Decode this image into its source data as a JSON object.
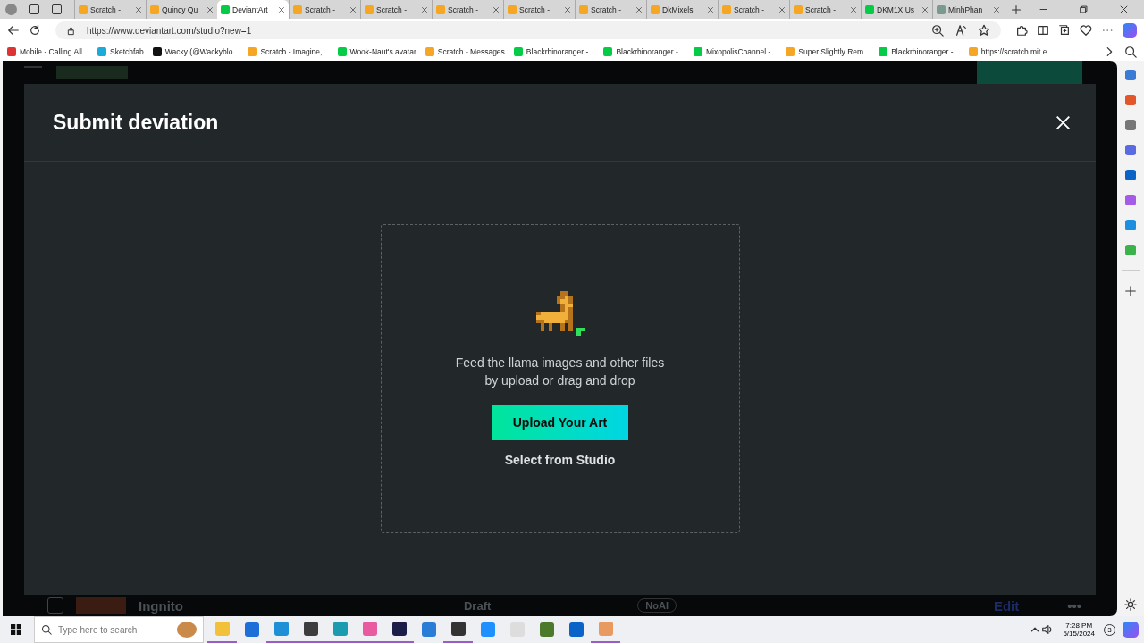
{
  "browser": {
    "tabs": [
      {
        "title": "Scratch -",
        "kind": "scratch",
        "selected": false
      },
      {
        "title": "Quincy Qu",
        "kind": "scratch",
        "selected": false
      },
      {
        "title": "DeviantArt",
        "kind": "deviantart",
        "selected": true
      },
      {
        "title": "Scratch -",
        "kind": "scratch",
        "selected": false
      },
      {
        "title": "Scratch -",
        "kind": "scratch",
        "selected": false
      },
      {
        "title": "Scratch -",
        "kind": "scratch",
        "selected": false
      },
      {
        "title": "Scratch -",
        "kind": "scratch",
        "selected": false
      },
      {
        "title": "Scratch -",
        "kind": "scratch",
        "selected": false
      },
      {
        "title": "DkMixels",
        "kind": "scratch",
        "selected": false
      },
      {
        "title": "Scratch -",
        "kind": "scratch",
        "selected": false
      },
      {
        "title": "Scratch -",
        "kind": "scratch",
        "selected": false
      },
      {
        "title": "DKM1X Us",
        "kind": "deviantart",
        "selected": false
      },
      {
        "title": "MinhPhan",
        "kind": "generic",
        "selected": false
      }
    ],
    "address": "https://www.deviantart.com/studio?new=1",
    "bookmarks": [
      {
        "title": "Mobile - Calling All...",
        "kind": "app"
      },
      {
        "title": "Sketchfab",
        "kind": "sketchfab"
      },
      {
        "title": "Wacky (@Wackyblo...",
        "kind": "x"
      },
      {
        "title": "Scratch - Imagine,...",
        "kind": "scratch"
      },
      {
        "title": "Wook-Naut's avatar",
        "kind": "deviantart"
      },
      {
        "title": "Scratch - Messages",
        "kind": "scratch"
      },
      {
        "title": "Blackrhinoranger -...",
        "kind": "deviantart"
      },
      {
        "title": "Blackrhinoranger -...",
        "kind": "deviantart"
      },
      {
        "title": "MixopolisChannel -...",
        "kind": "deviantart"
      },
      {
        "title": "Super Slightly Rem...",
        "kind": "scratch"
      },
      {
        "title": "Blackrhinoranger -...",
        "kind": "deviantart"
      },
      {
        "title": "https://scratch.mit.e...",
        "kind": "scratch"
      }
    ]
  },
  "modal": {
    "title": "Submit deviation",
    "prompt_line_1": "Feed the llama images and other files",
    "prompt_line_2": "by upload or drag and drop",
    "upload_button": "Upload Your Art",
    "studio_link": "Select from Studio"
  },
  "background_row": {
    "checked": false,
    "name": "Ingnito",
    "status": "Draft",
    "tag": "NoAI",
    "action": "Edit",
    "more": "•••"
  },
  "taskbar": {
    "search_placeholder": "Type here to search",
    "time": "7:28 PM",
    "date": "5/15/2024",
    "notifications": "3",
    "apps": [
      {
        "running": true
      },
      {
        "running": false
      },
      {
        "running": true
      },
      {
        "running": true
      },
      {
        "running": true
      },
      {
        "running": true
      },
      {
        "running": true
      },
      {
        "running": false
      },
      {
        "running": true
      },
      {
        "running": false
      },
      {
        "running": false
      },
      {
        "running": false
      },
      {
        "running": false
      },
      {
        "running": true
      }
    ]
  }
}
